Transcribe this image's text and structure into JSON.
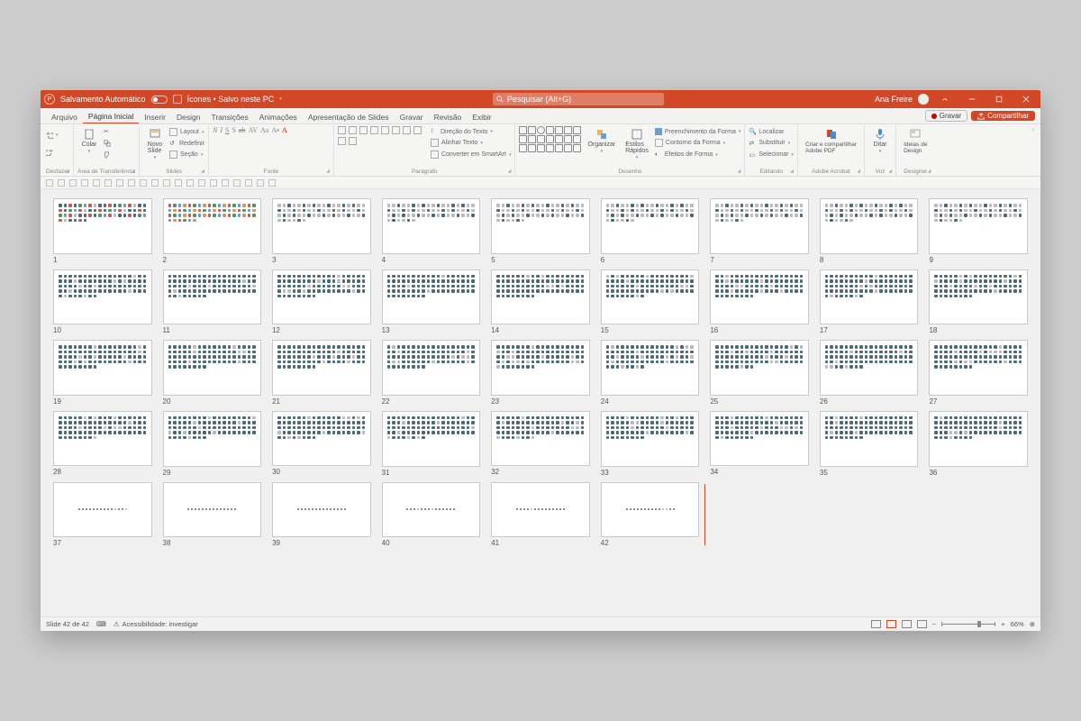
{
  "title": {
    "autosave_label": "Salvamento Automático",
    "filename": "Ícones • Salvo neste PC",
    "search_placeholder": "Pesquisar (Alt+G)",
    "user_name": "Ana Freire"
  },
  "tabs": {
    "active": "Página Inicial",
    "items": [
      "Arquivo",
      "Página Inicial",
      "Inserir",
      "Design",
      "Transições",
      "Animações",
      "Apresentação de Slides",
      "Gravar",
      "Revisão",
      "Exibir"
    ],
    "record_label": "Gravar",
    "share_label": "Compartilhar"
  },
  "ribbon": {
    "g_undo": "Desfazer",
    "g_clipboard": "Área de Transferência",
    "paste": "Colar",
    "g_slides": "Slides",
    "new_slide": "Novo\nSlide",
    "layout": "Layout",
    "reset": "Redefinir",
    "section": "Seção",
    "g_font": "Fonte",
    "g_paragraph": "Parágrafo",
    "text_dir": "Direção do Texto",
    "align_text": "Alinhar Texto",
    "convert_smartart": "Converter em SmartArt",
    "g_drawing": "Desenho",
    "arrange": "Organizar",
    "quick_styles": "Estilos\nRápidos",
    "shape_fill": "Preenchimento da Forma",
    "shape_outline": "Contorno da Forma",
    "shape_effects": "Efeitos de Forma",
    "g_editing": "Editando",
    "find": "Localizar",
    "replace": "Substituir",
    "select": "Selecionar",
    "g_acrobat": "Adobe Acrobat",
    "acrobat_btn": "Criar e compartilhar\nAdobe PDF",
    "g_voice": "Voz",
    "dictate": "Ditar",
    "g_designer": "Designer",
    "designer": "Ideias de\nDesign"
  },
  "slides": {
    "count": 42,
    "current": 42
  },
  "status": {
    "slide_text": "Slide 42 de 42",
    "accessibility": "Acessibilidade: investigar",
    "zoom_value": "66%"
  }
}
